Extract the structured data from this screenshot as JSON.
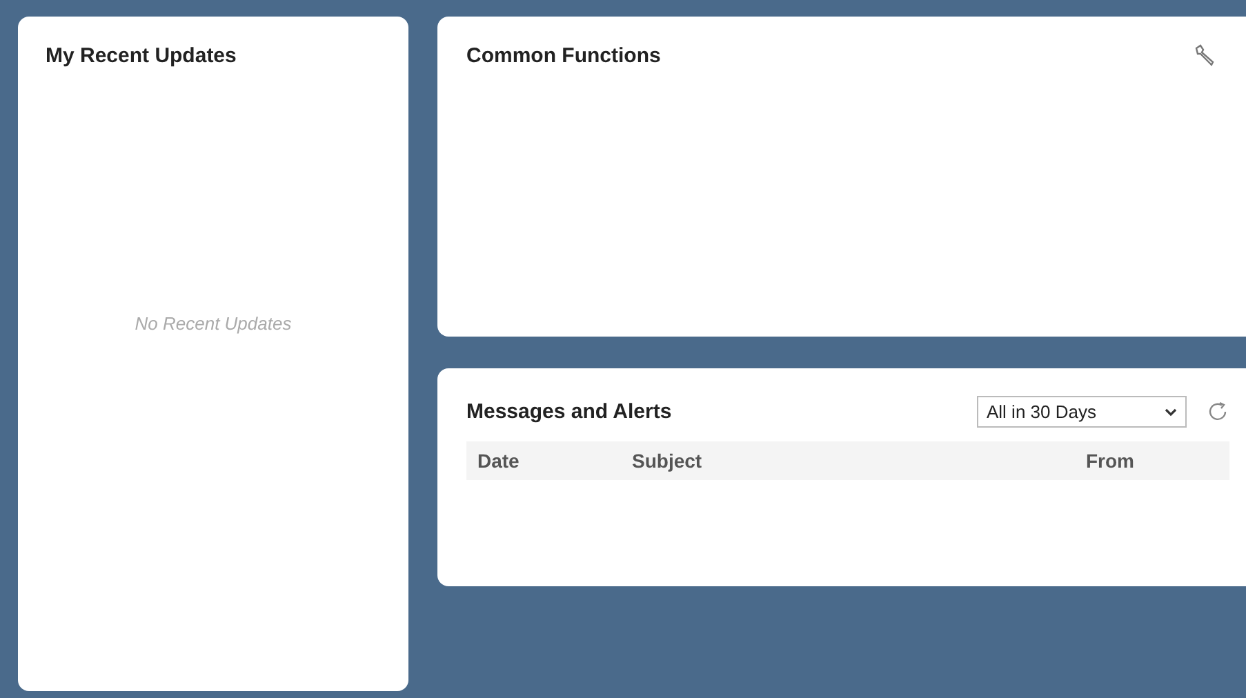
{
  "recent_updates": {
    "title": "My Recent Updates",
    "empty_text": "No Recent Updates"
  },
  "common_functions": {
    "title": "Common Functions"
  },
  "messages": {
    "title": "Messages and Alerts",
    "filter": {
      "value": "All in 30 Days"
    },
    "columns": [
      "Date",
      "Subject",
      "From"
    ]
  }
}
